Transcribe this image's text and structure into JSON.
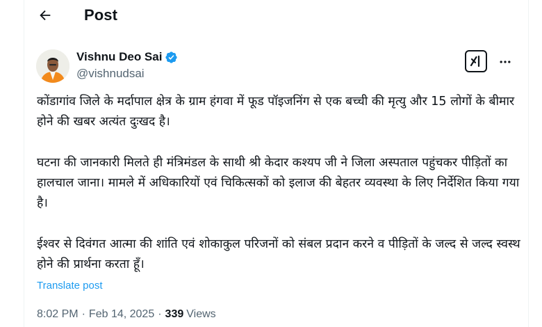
{
  "header": {
    "title": "Post"
  },
  "author": {
    "display_name": "Vishnu Deo Sai",
    "handle": "@vishnudsai",
    "verified": true,
    "verified_color": "#1d9bf0"
  },
  "tweet": {
    "paragraphs": [
      "कोंडागांव जिले के मर्दापाल क्षेत्र के ग्राम हंगवा में फूड पॉइजनिंग से एक बच्ची की मृत्यु और 15 लोगों के बीमार होने की खबर अत्यंत दुःखद है।",
      "घटना की जानकारी मिलते ही मंत्रिमंडल के साथी श्री केदार कश्यप जी ने जिला अस्पताल पहुंचकर पीड़ितों का हालचाल जाना। मामले में अधिकारियों एवं चिकित्सकों को इलाज की बेहतर व्यवस्था के लिए निर्देशित किया गया है।",
      "ईश्वर से दिवंगत आत्मा की शांति एवं शोकाकुल परिजनों को संबल प्रदान करने व पीड़ितों के जल्द से जल्द स्वस्थ होने की प्रार्थना करता हूँ।"
    ],
    "translate_label": "Translate post"
  },
  "meta": {
    "time": "8:02 PM",
    "separator": "·",
    "date": "Feb 14, 2025",
    "views_count": "339",
    "views_label": "Views"
  },
  "colors": {
    "link": "#1d9bf0",
    "secondary_text": "#536471",
    "primary_text": "#0f1419"
  },
  "icons": {
    "back": "arrow-left-icon",
    "verified": "verified-badge-icon",
    "grok": "grok-icon",
    "more": "more-icon"
  }
}
